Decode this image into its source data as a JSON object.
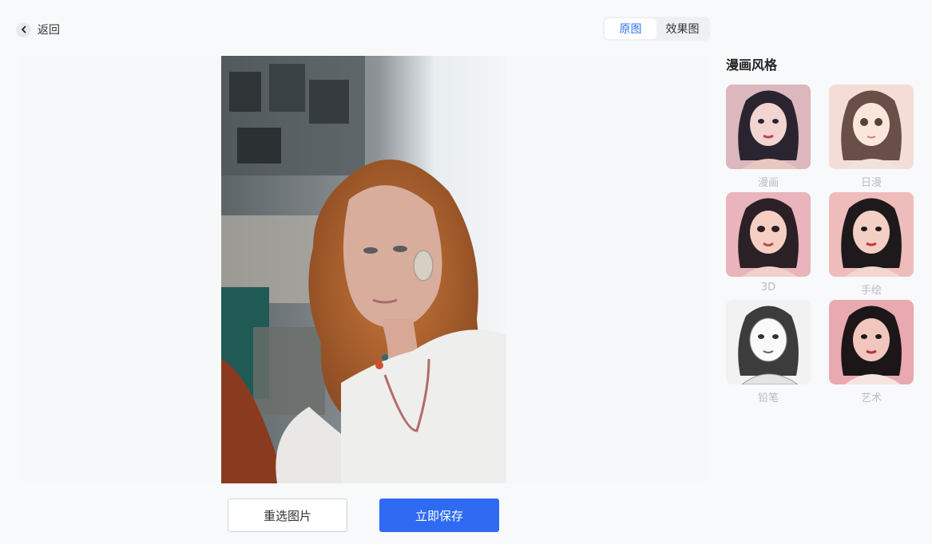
{
  "header": {
    "back_label": "返回"
  },
  "view_toggle": {
    "original_label": "原图",
    "effect_label": "效果图",
    "active": "original"
  },
  "panel": {
    "title": "漫画风格",
    "styles": [
      {
        "label": "漫画"
      },
      {
        "label": "日漫"
      },
      {
        "label": "3D"
      },
      {
        "label": "手绘"
      },
      {
        "label": "铅笔"
      },
      {
        "label": "艺术"
      }
    ]
  },
  "actions": {
    "reselect_label": "重选图片",
    "save_label": "立即保存"
  },
  "colors": {
    "accent": "#2f6bf2",
    "active_tab_text": "#2b73f0",
    "style_label": "#b7bcc4"
  }
}
